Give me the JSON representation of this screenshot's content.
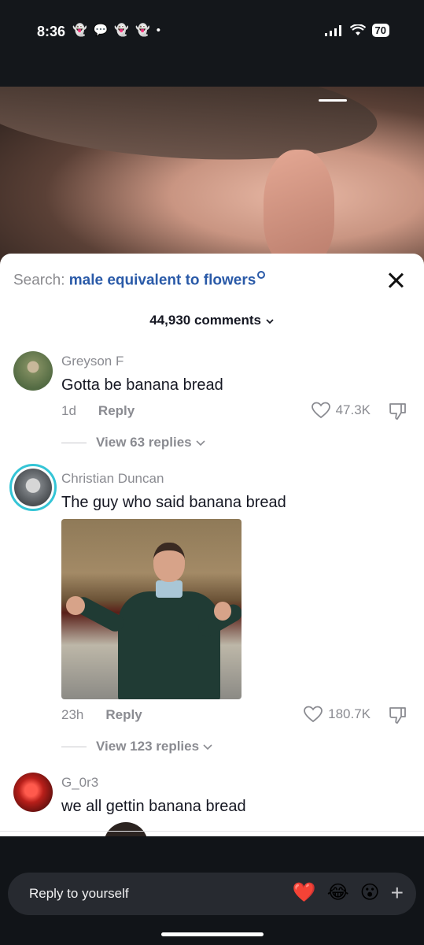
{
  "status_bar": {
    "time": "8:36",
    "notification_icons": [
      "snapchat-ghost-icon",
      "chat-bubble-icon",
      "snapchat-ghost-icon",
      "snapchat-ghost-icon",
      "dot-icon"
    ],
    "battery": "70"
  },
  "sheet": {
    "search_prefix": "Search:",
    "search_term": "male equivalent to flowers",
    "comments_count": "44,930 comments"
  },
  "comments": [
    {
      "author": "Greyson F",
      "text": "Gotta be banana bread",
      "age": "1d",
      "reply_label": "Reply",
      "likes": "47.3K",
      "view_replies": "View 63 replies"
    },
    {
      "author": "Christian Duncan",
      "text": "The guy who said banana bread",
      "age": "23h",
      "reply_label": "Reply",
      "likes": "180.7K",
      "view_replies": "View 123 replies"
    },
    {
      "author": "G_0r3",
      "text": "we all gettin banana bread"
    }
  ],
  "composer": {
    "placeholder": "Reply to yourself",
    "reactions": [
      "❤️",
      "😂",
      "😮"
    ],
    "plus": "+"
  },
  "colors": {
    "search_term": "#2a5aa8",
    "story_ring": "#34c5d6",
    "sheet_bg": "#ffffff"
  }
}
